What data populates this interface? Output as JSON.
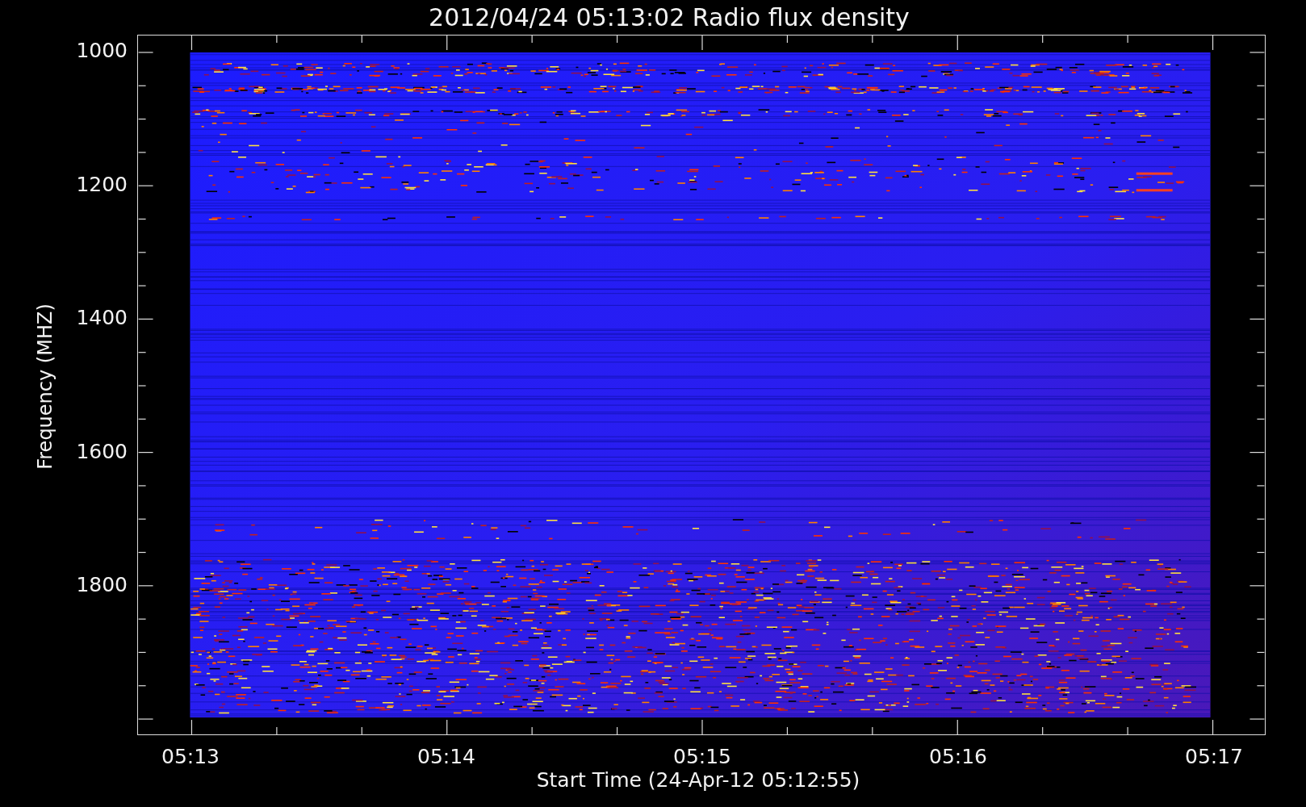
{
  "title": "2012/04/24 05:13:02 Radio flux density",
  "y_axis": {
    "label": "Frequency (MHZ)",
    "ticks": [
      "1000",
      "1200",
      "1400",
      "1600",
      "1800"
    ]
  },
  "x_axis": {
    "label": "Start Time (24-Apr-12 05:12:55)",
    "ticks": [
      "05:13",
      "05:14",
      "05:15",
      "05:16",
      "05:17"
    ]
  }
}
